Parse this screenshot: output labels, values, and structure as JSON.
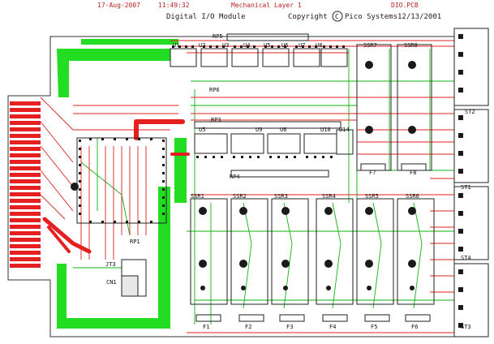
{
  "header": {
    "date": "17-Aug-2007",
    "time": "11:49:32",
    "layer": "Mechanical Layer 1",
    "file": "DIO.PCB"
  },
  "board": {
    "title": "Digital I/O Module",
    "copyright": "Copyright",
    "copyright_symbol": "C",
    "company": "Pico Systems",
    "date": "12/13/2001"
  },
  "parts": {
    "resistor_packs": [
      "RP5",
      "RP6",
      "RP3",
      "RP4",
      "RP1"
    ],
    "ics_top": [
      "U1",
      "U2",
      "U3",
      "U4",
      "U5",
      "U6",
      "U7",
      "U8"
    ],
    "ics_mid": [
      "U5",
      "U9",
      "U6",
      "U10",
      "U14"
    ],
    "ssr_top": [
      "SSR7",
      "SSR8"
    ],
    "ssr_bottom": [
      "SSR1",
      "SSR2",
      "SSR3",
      "SSR4",
      "SSR5",
      "SSR6"
    ],
    "fuses": [
      "F1",
      "F2",
      "F3",
      "F4",
      "F5",
      "F6"
    ],
    "fuses_top": [
      "F7",
      "F8"
    ],
    "terminals": [
      "ST2",
      "ST1",
      "ST4",
      "ST3"
    ],
    "jumpers": [
      "JT3",
      "CN1"
    ]
  },
  "colors": {
    "background": "#ffffff",
    "trace_red": "#e02020",
    "trace_green": "#10c010",
    "ground_fill": "#22e022",
    "pad": "#1a1a1a",
    "silk": "#222222"
  }
}
